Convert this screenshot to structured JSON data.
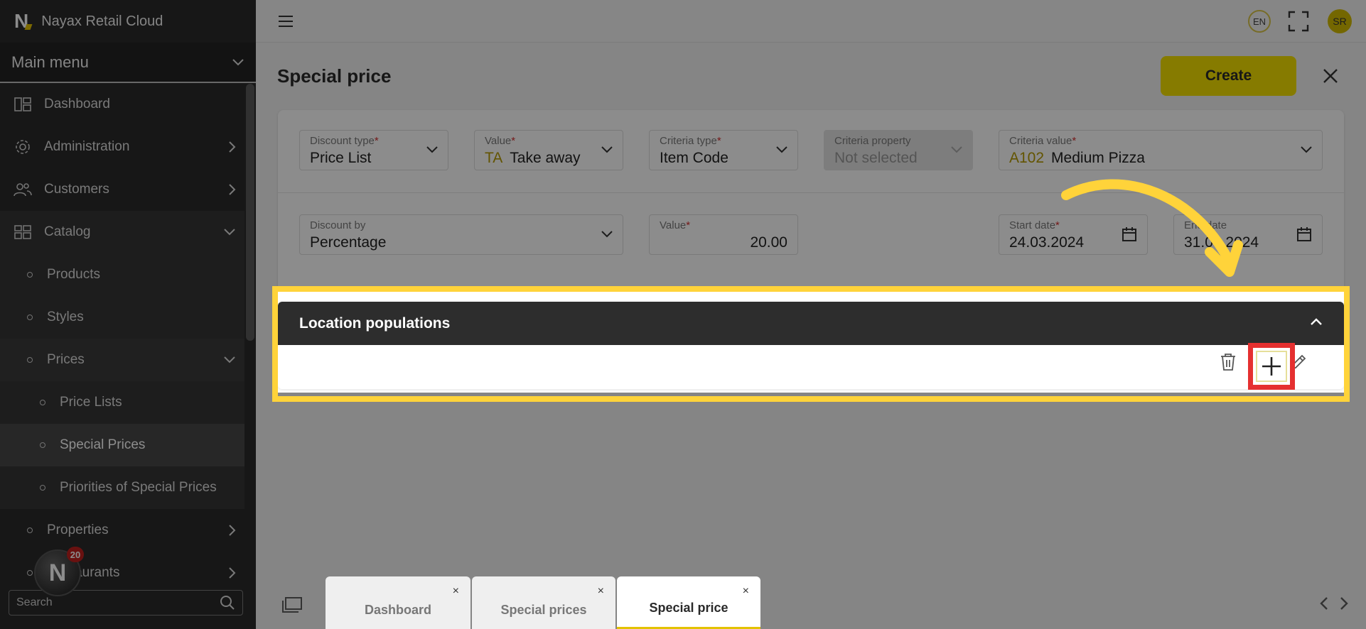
{
  "app": {
    "title": "Nayax Retail Cloud",
    "logo_letter": "N"
  },
  "sidebar": {
    "menu_title": "Main menu",
    "items": [
      {
        "label": "Dashboard",
        "icon": "dashboard-icon"
      },
      {
        "label": "Administration",
        "icon": "gear-icon"
      },
      {
        "label": "Customers",
        "icon": "users-icon"
      },
      {
        "label": "Catalog",
        "icon": "grid-icon"
      },
      {
        "label": "Products"
      },
      {
        "label": "Styles"
      },
      {
        "label": "Prices"
      },
      {
        "label": "Price Lists"
      },
      {
        "label": "Special Prices"
      },
      {
        "label": "Priorities of Special Prices"
      },
      {
        "label": "Properties"
      },
      {
        "label": "Restaurants"
      }
    ],
    "search_placeholder": "Search",
    "badge_count": "20",
    "fab_letter": "N"
  },
  "header": {
    "language": "EN",
    "user_initials": "SR"
  },
  "page": {
    "title": "Special price",
    "create_label": "Create",
    "fields": {
      "discount_type": {
        "label": "Discount type",
        "value": "Price List"
      },
      "value1": {
        "label": "Value",
        "code": "TA",
        "value": "Take away"
      },
      "criteria_type": {
        "label": "Criteria type",
        "value": "Item Code"
      },
      "criteria_property": {
        "label": "Criteria property",
        "value": "Not selected"
      },
      "criteria_value": {
        "label": "Criteria value",
        "code": "A102",
        "value": "Medium Pizza"
      },
      "discount_by": {
        "label": "Discount by",
        "value": "Percentage"
      },
      "value2": {
        "label": "Value",
        "value": "20.00"
      },
      "start_date": {
        "label": "Start date",
        "value": "24.03.2024"
      },
      "end_date": {
        "label": "End date",
        "value": "31.03.2024"
      }
    },
    "required_mark": "*",
    "location_panel": {
      "title": "Location populations"
    }
  },
  "tabs": [
    {
      "label": "Dashboard",
      "close": "×"
    },
    {
      "label": "Special prices",
      "close": "×"
    },
    {
      "label": "Special price",
      "close": "×"
    }
  ],
  "colors": {
    "accent": "#f5e000",
    "highlight": "#ffd33a",
    "red": "#e53030"
  }
}
